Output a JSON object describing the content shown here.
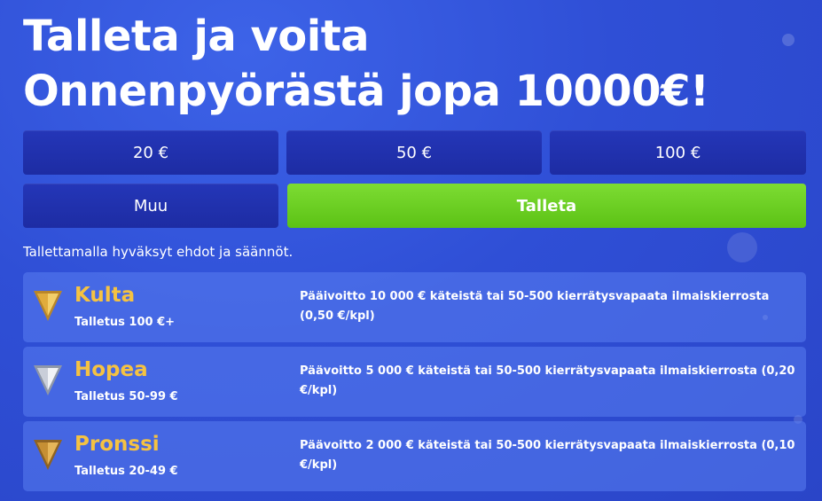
{
  "headline": {
    "line1": "Talleta ja voita",
    "line2": "Onnenpyörästä jopa 10000€!"
  },
  "amounts": [
    "20 €",
    "50 €",
    "100 €"
  ],
  "other_label": "Muu",
  "deposit_label": "Talleta",
  "terms_text": "Tallettamalla hyväksyt ehdot ja säännöt.",
  "tiers": [
    {
      "name": "Kulta",
      "deposit": "Talletus 100 €+",
      "prize": "Pääivoitto 10 000 € käteistä tai 50-500 kierrätysvapaata ilmaiskierrosta (0,50 €/kpl)",
      "icon": "gold-chevron-icon",
      "color": "#e9b84a"
    },
    {
      "name": "Hopea",
      "deposit": "Talletus 50-99 €",
      "prize": "Päävoitto 5 000 € käteistä tai 50-500 kierrätysvapaata ilmaiskierrosta (0,20 €/kpl)",
      "icon": "silver-chevron-icon",
      "color": "#d6dbe6"
    },
    {
      "name": "Pronssi",
      "deposit": "Talletus 20-49 €",
      "prize": "Päävoitto 2 000 € käteistä tai 50-500 kierrätysvapaata ilmaiskierrosta (0,10 €/kpl)",
      "icon": "bronze-chevron-icon",
      "color": "#d1a043"
    }
  ],
  "colors": {
    "background": "#2f4fd6",
    "button_dark": "#1f2fa8",
    "button_green": "#6ccf22",
    "tier_name": "#f5c242"
  }
}
